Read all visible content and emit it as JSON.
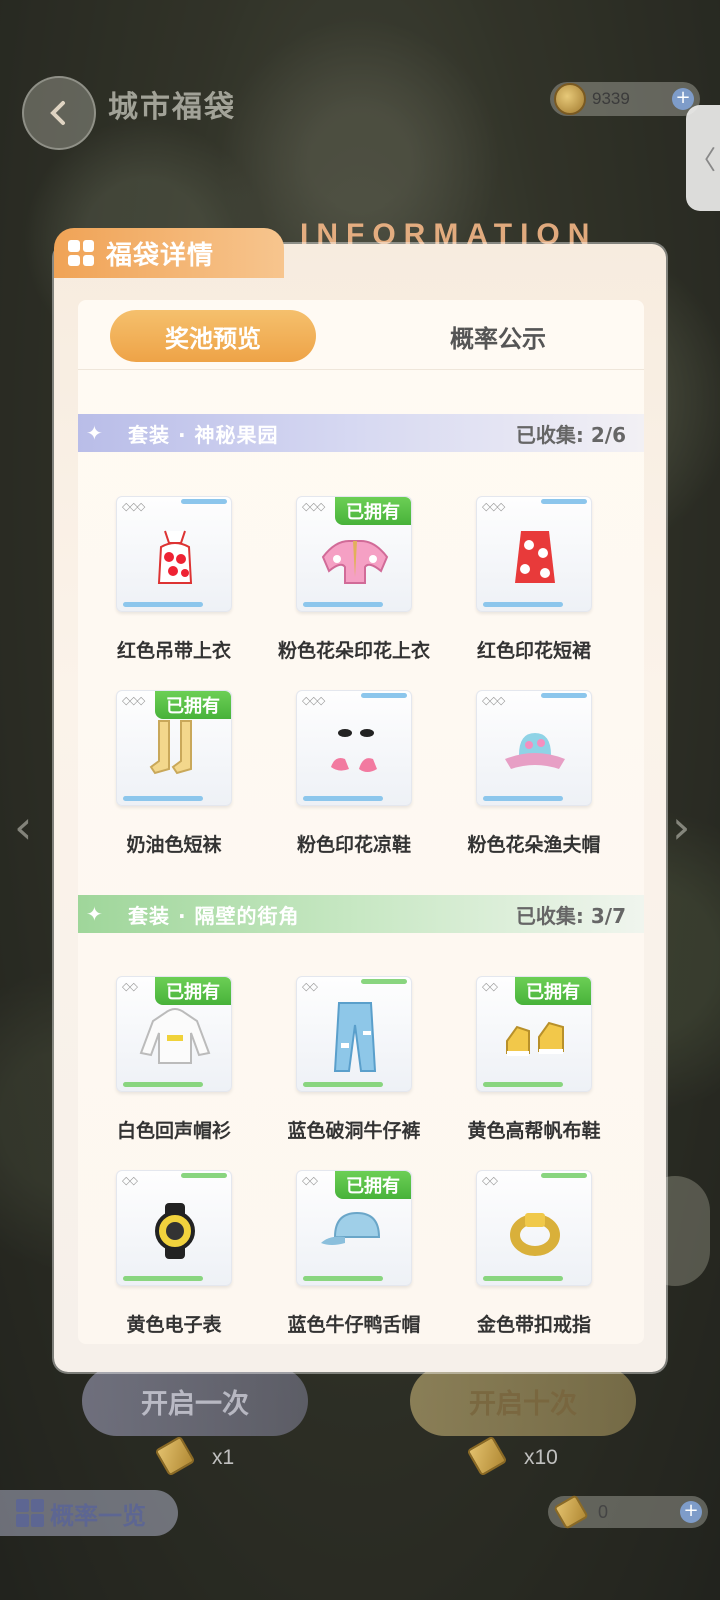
{
  "header": {
    "title": "城市福袋",
    "coins": "9339",
    "deco_text": "INFORMATION"
  },
  "modal": {
    "title": "福袋详情",
    "tabs": [
      "奖池预览",
      "概率公示"
    ],
    "sets": [
      {
        "name": "套装 · 神秘果园",
        "collected_label": "已收集:",
        "collected": "2/6",
        "items": [
          {
            "name": "红色吊带上衣",
            "owned": false,
            "icon": "red-camisole-icon"
          },
          {
            "name": "粉色花朵印花上衣",
            "owned": true,
            "icon": "pink-floral-top-icon"
          },
          {
            "name": "红色印花短裙",
            "owned": false,
            "icon": "red-print-skirt-icon"
          },
          {
            "name": "奶油色短袜",
            "owned": true,
            "icon": "cream-socks-icon"
          },
          {
            "name": "粉色印花凉鞋",
            "owned": false,
            "icon": "pink-sandals-icon"
          },
          {
            "name": "粉色花朵渔夫帽",
            "owned": false,
            "icon": "pink-bucket-hat-icon"
          }
        ]
      },
      {
        "name": "套装 · 隔壁的街角",
        "collected_label": "已收集:",
        "collected": "3/7",
        "items": [
          {
            "name": "白色回声帽衫",
            "owned": true,
            "icon": "white-hoodie-icon"
          },
          {
            "name": "蓝色破洞牛仔裤",
            "owned": false,
            "icon": "ripped-jeans-icon"
          },
          {
            "name": "黄色高帮帆布鞋",
            "owned": true,
            "icon": "yellow-sneakers-icon"
          },
          {
            "name": "黄色电子表",
            "owned": false,
            "icon": "yellow-watch-icon"
          },
          {
            "name": "蓝色牛仔鸭舌帽",
            "owned": true,
            "icon": "denim-cap-icon"
          },
          {
            "name": "金色带扣戒指",
            "owned": false,
            "icon": "gold-ring-icon"
          }
        ]
      }
    ],
    "owned_label": "已拥有"
  },
  "bottom": {
    "open_once": "开启一次",
    "open_ten": "开启十次",
    "cost_once": "x1",
    "cost_ten": "x10",
    "rate_list": "概率一览",
    "tickets": "0"
  }
}
